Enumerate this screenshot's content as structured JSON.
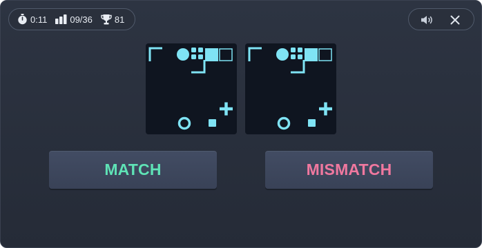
{
  "hud": {
    "timer": "0:11",
    "progress": "09/36",
    "score": "81",
    "icons": [
      "stopwatch-icon",
      "bars-icon",
      "trophy-icon",
      "speaker-icon",
      "close-icon"
    ]
  },
  "buttons": {
    "match_label": "MATCH",
    "mismatch_label": "MISMATCH"
  },
  "colors": {
    "background": "#2b313d",
    "card": "#0f1520",
    "shape": "#7fe3f4",
    "match": "#5fe3b6",
    "mismatch": "#f0789f",
    "text": "#e9edf3"
  },
  "cards": [
    {
      "name": "left-card",
      "shapes": [
        "corner-bracket-top-left",
        "filled-circle",
        "dot-grid",
        "filled-square",
        "outlined-square",
        "corner-bracket-bottom-right",
        "plus",
        "ring",
        "small-square"
      ]
    },
    {
      "name": "right-card",
      "shapes": [
        "corner-bracket-top-left",
        "filled-circle",
        "dot-grid",
        "filled-square",
        "outlined-square",
        "corner-bracket-bottom-right",
        "plus",
        "ring",
        "small-square"
      ]
    }
  ]
}
